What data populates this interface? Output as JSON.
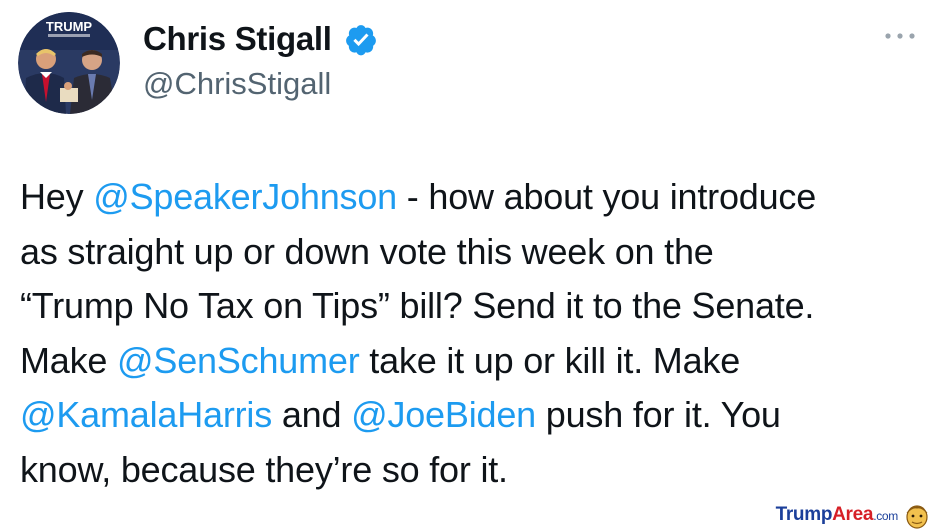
{
  "author": {
    "display_name": "Chris Stigall",
    "handle": "@ChrisStigall",
    "avatar_banner_text": "TRUMP",
    "verified": true
  },
  "menu": {
    "more_icon": "more-horizontal-icon"
  },
  "tweet": {
    "lines": [
      [
        {
          "t": "Hey "
        },
        {
          "t": "@SpeakerJohnson",
          "mention": true
        },
        {
          "t": " - how about you introduce"
        }
      ],
      [
        {
          "t": "as straight up or down vote this week on the"
        }
      ],
      [
        {
          "t": "“Trump No Tax on Tips” bill?  Send it to the Senate."
        }
      ],
      [
        {
          "t": "Make "
        },
        {
          "t": "@SenSchumer",
          "mention": true
        },
        {
          "t": " take it up or kill it.  Make"
        }
      ],
      [
        {
          "t": "@KamalaHarris",
          "mention": true
        },
        {
          "t": " and "
        },
        {
          "t": "@JoeBiden",
          "mention": true
        },
        {
          "t": " push for it.  You"
        }
      ],
      [
        {
          "t": "know, because they’re so for it."
        }
      ]
    ]
  },
  "watermark": {
    "part1": "Trump",
    "part2": "Area",
    "suffix": ".com"
  },
  "colors": {
    "mention": "#1d9bf0",
    "verified_badge": "#1d9bf0",
    "secondary_text": "#536471",
    "watermark_blue": "#1b3f9a",
    "watermark_red": "#d61f26"
  }
}
